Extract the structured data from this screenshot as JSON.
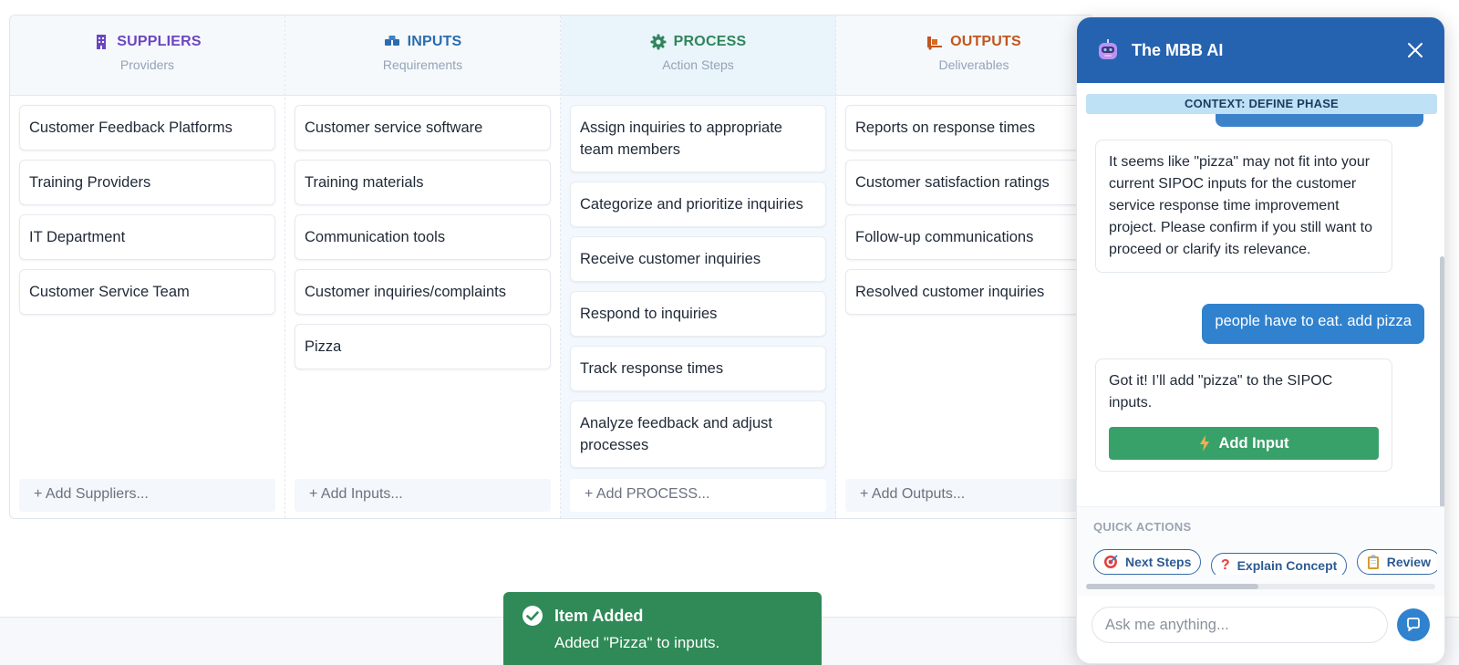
{
  "columns": [
    {
      "key": "suppliers",
      "title": "SUPPLIERS",
      "subtitle": "Providers",
      "color": "#6b46c1",
      "items": [
        "Customer Feedback Platforms",
        "Training Providers",
        "IT Department",
        "Customer Service Team"
      ],
      "add_label": "+ Add Suppliers..."
    },
    {
      "key": "inputs",
      "title": "INPUTS",
      "subtitle": "Requirements",
      "color": "#2b6cb0",
      "items": [
        "Customer service software",
        "Training materials",
        "Communication tools",
        "Customer inquiries/complaints",
        "Pizza"
      ],
      "add_label": "+ Add Inputs..."
    },
    {
      "key": "process",
      "title": "PROCESS",
      "subtitle": "Action Steps",
      "color": "#2f855a",
      "items": [
        "Assign inquiries to appropriate team members",
        "Categorize and prioritize inquiries",
        "Receive customer inquiries",
        "Respond to inquiries",
        "Track response times",
        "Analyze feedback and adjust processes"
      ],
      "add_label": "+ Add PROCESS..."
    },
    {
      "key": "outputs",
      "title": "OUTPUTS",
      "subtitle": "Deliverables",
      "color": "#c05621",
      "items": [
        "Reports on response times",
        "Customer satisfaction ratings",
        "Follow-up communications",
        "Resolved customer inquiries"
      ],
      "add_label": "+ Add Outputs..."
    }
  ],
  "toast": {
    "title": "Item Added",
    "message": "Added \"Pizza\" to inputs."
  },
  "chat": {
    "title": "The MBB AI",
    "context": "CONTEXT: DEFINE PHASE",
    "messages": {
      "bot1": "It seems like \"pizza\" may not fit into your current SIPOC inputs for the customer service response time improvement project. Please confirm if you still want to proceed or clarify its relevance.",
      "user1": "people have to eat. add pizza",
      "bot2": "Got it! I’ll add \"pizza\" to the SIPOC inputs."
    },
    "add_input_label": "Add Input",
    "quick_actions_label": "QUICK ACTIONS",
    "quick_actions": [
      "Next Steps",
      "Explain Concept",
      "Review"
    ],
    "input_placeholder": "Ask me anything..."
  },
  "colors": {
    "header_blue": "#2563b0",
    "toast_green": "#2f8a57",
    "button_green": "#38a169",
    "user_bubble": "#3182ce"
  }
}
